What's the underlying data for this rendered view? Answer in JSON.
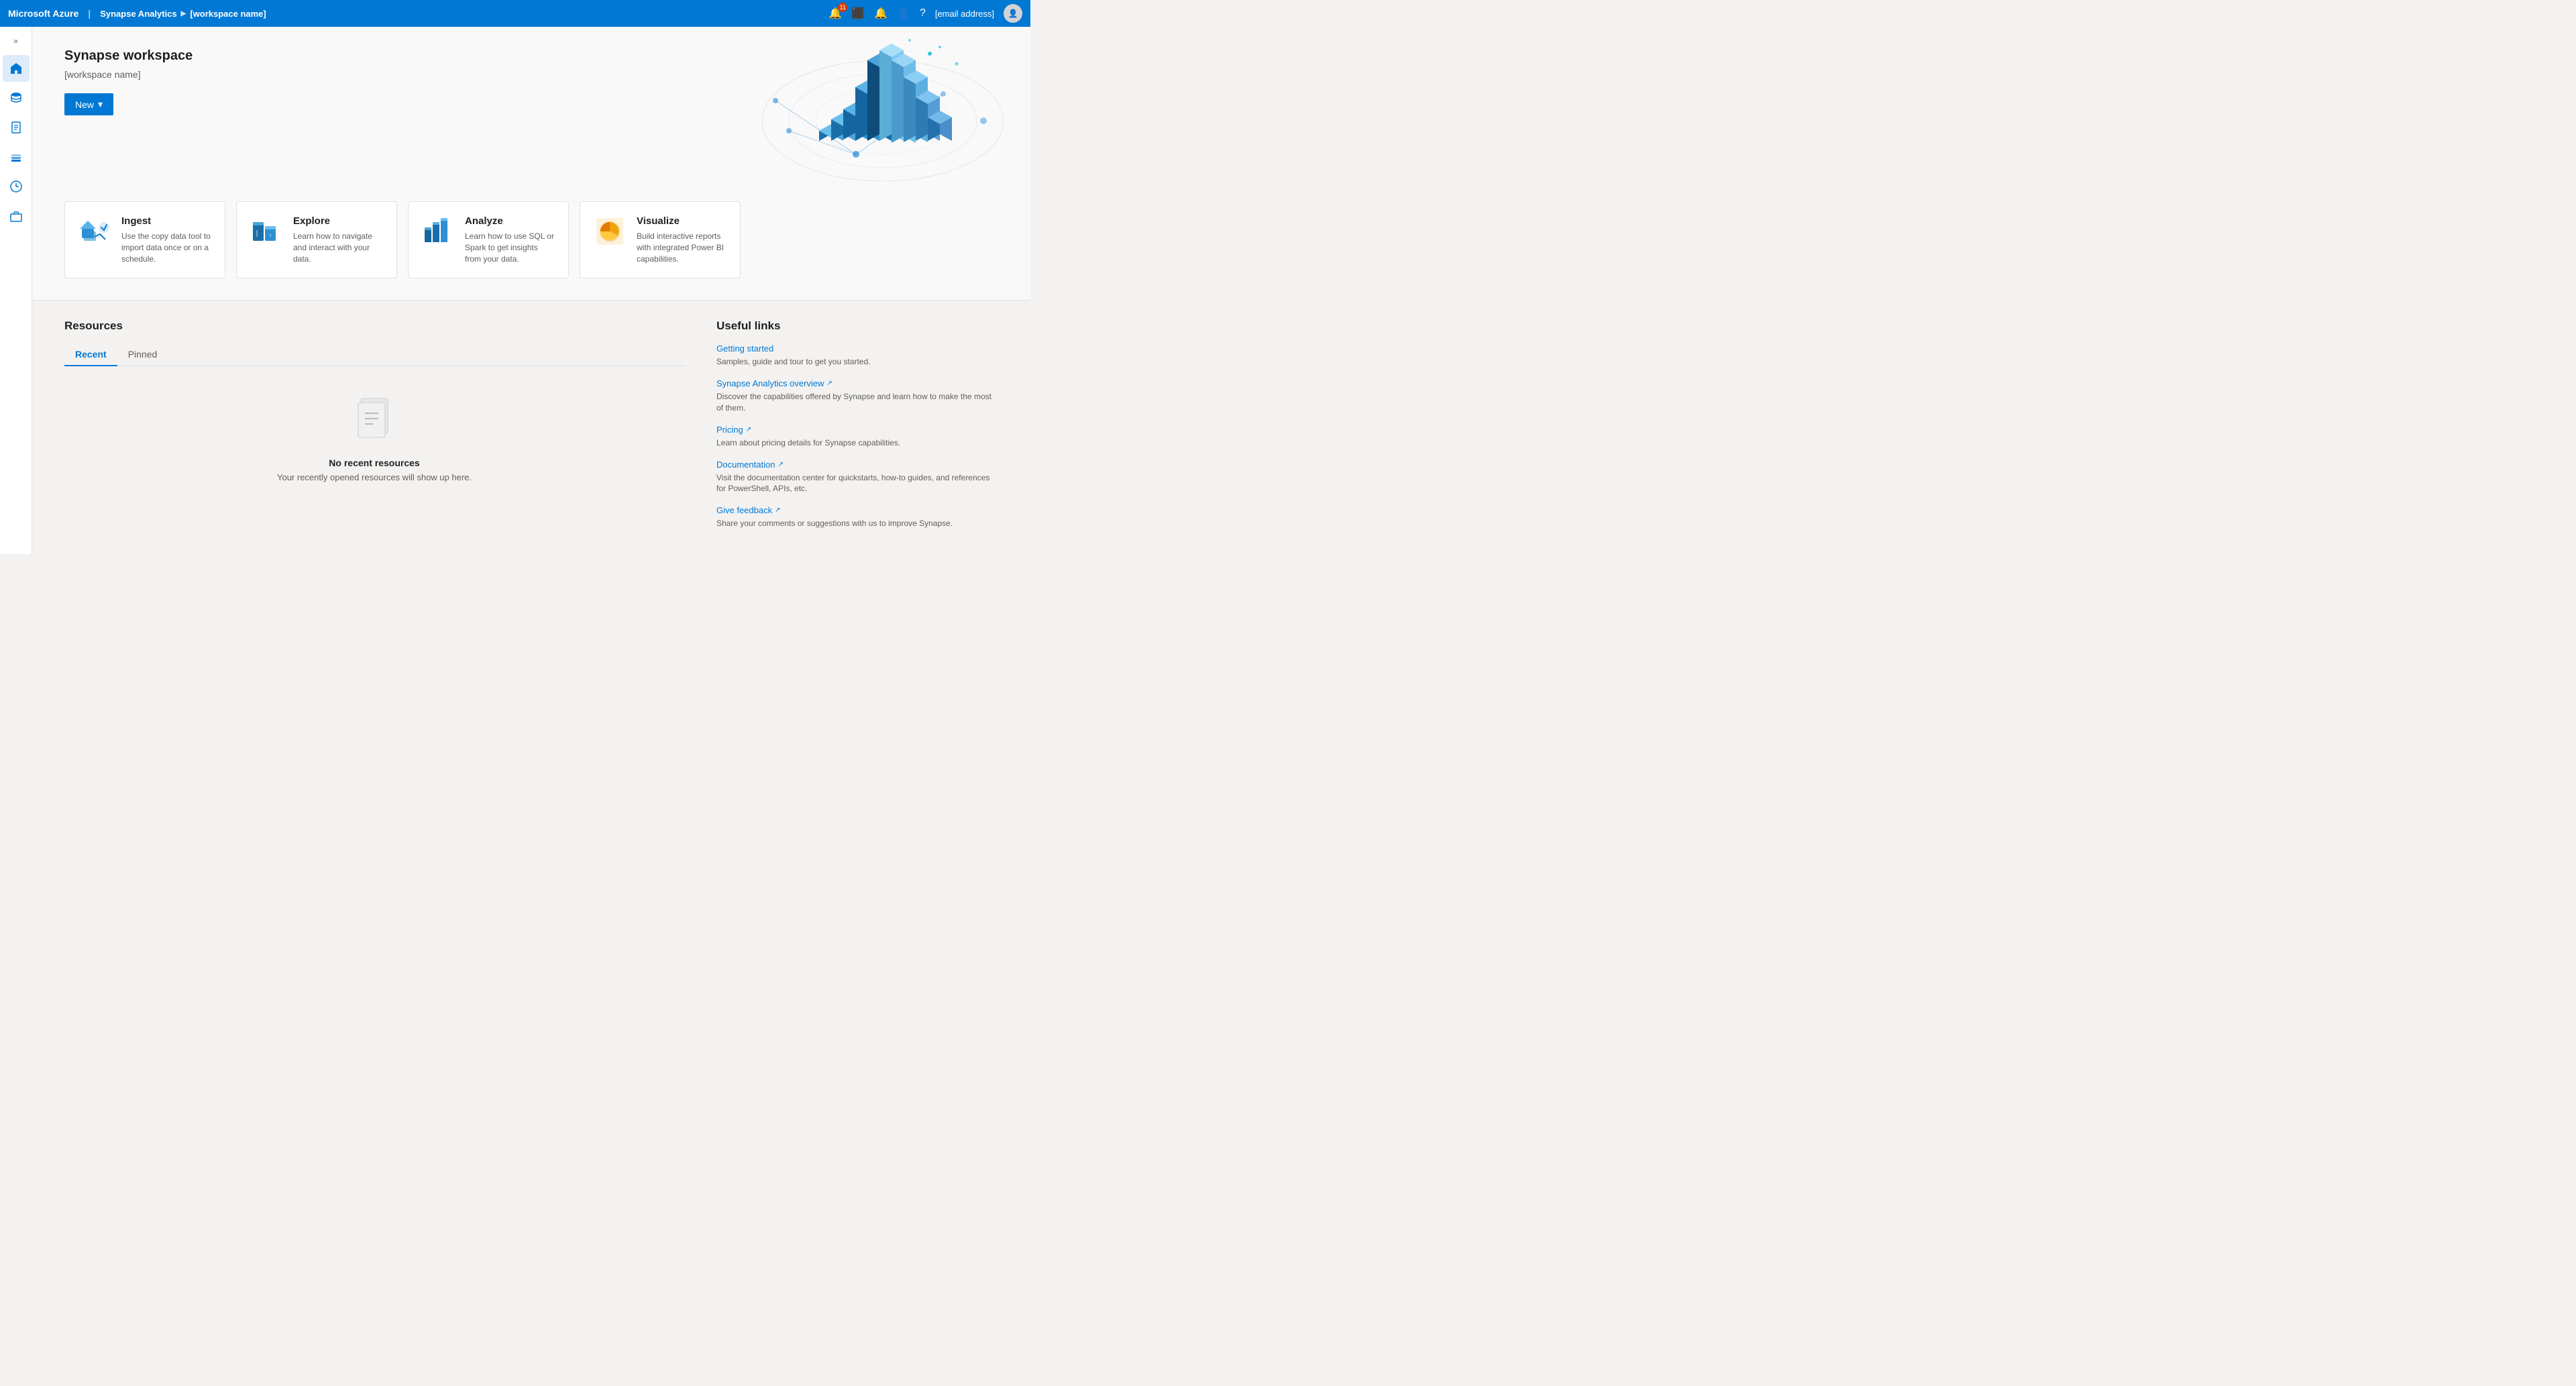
{
  "topbar": {
    "brand": "Microsoft Azure",
    "service": "Synapse Analytics",
    "workspace": "[workspace name]",
    "badge_count": "11",
    "email": "[email address]"
  },
  "sidebar": {
    "toggle_icon": "»",
    "items": [
      {
        "name": "home",
        "icon": "🏠"
      },
      {
        "name": "database",
        "icon": "🗄"
      },
      {
        "name": "document",
        "icon": "📄"
      },
      {
        "name": "layers",
        "icon": "📦"
      },
      {
        "name": "monitor",
        "icon": "⏱"
      },
      {
        "name": "briefcase",
        "icon": "💼"
      }
    ]
  },
  "hero": {
    "title": "Synapse workspace",
    "subtitle": "[workspace name]",
    "new_button": "New"
  },
  "cards": [
    {
      "id": "ingest",
      "title": "Ingest",
      "description": "Use the copy data tool to import data once or on a schedule."
    },
    {
      "id": "explore",
      "title": "Explore",
      "description": "Learn how to navigate and interact with your data."
    },
    {
      "id": "analyze",
      "title": "Analyze",
      "description": "Learn how to use SQL or Spark to get insights from your data."
    },
    {
      "id": "visualize",
      "title": "Visualize",
      "description": "Build interactive reports with integrated Power BI capabilities."
    }
  ],
  "resources": {
    "title": "Resources",
    "tabs": [
      "Recent",
      "Pinned"
    ],
    "active_tab": "Recent",
    "empty_title": "No recent resources",
    "empty_desc": "Your recently opened resources will show up here."
  },
  "useful_links": {
    "title": "Useful links",
    "links": [
      {
        "label": "Getting started",
        "desc": "Samples, guide and tour to get you started.",
        "external": false
      },
      {
        "label": "Synapse Analytics overview",
        "desc": "Discover the capabilities offered by Synapse and learn how to make the most of them.",
        "external": true
      },
      {
        "label": "Pricing",
        "desc": "Learn about pricing details for Synapse capabilities.",
        "external": true
      },
      {
        "label": "Documentation",
        "desc": "Visit the documentation center for quickstarts, how-to guides, and references for PowerShell, APIs, etc.",
        "external": true
      },
      {
        "label": "Give feedback",
        "desc": "Share your comments or suggestions with us to improve Synapse.",
        "external": true
      }
    ]
  }
}
